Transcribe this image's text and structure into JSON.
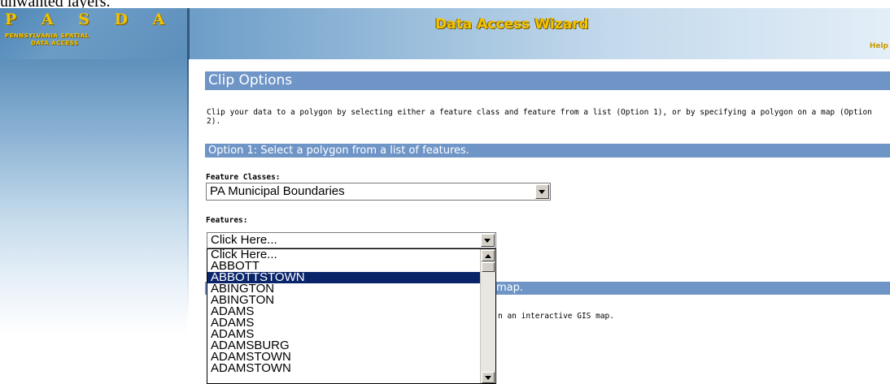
{
  "page_caption": "unwanted layers.",
  "header": {
    "logo_letters": "P A S D A",
    "logo_line1": "PENNSYLVANIA SPATIAL",
    "logo_line2": "DATA ACCESS",
    "title": "Data Access Wizard",
    "help_label": "Help"
  },
  "clip_options": {
    "heading": "Clip Options",
    "intro": "Clip your data to a polygon by selecting either a feature class and feature from a list (Option 1), or by specifying a polygon on a map (Option 2)."
  },
  "option1": {
    "heading": "Option 1: Select a polygon from a list of features.",
    "feature_classes_label": "Feature Classes:",
    "feature_classes_value": "PA Municipal Boundaries",
    "features_label": "Features:",
    "features_value": "Click Here...",
    "features_options": [
      "Click Here...",
      "ABBOTT",
      "ABBOTTSTOWN",
      "ABINGTON",
      "ABINGTON",
      "ADAMS",
      "ADAMS",
      "ADAMS",
      "ADAMSBURG",
      "ADAMSTOWN",
      "ADAMSTOWN"
    ],
    "selected_option_index": 2
  },
  "option2": {
    "heading_visible": "map.",
    "text_visible": "n an interactive GIS map."
  },
  "colors": {
    "section_bar": "#6f95c7",
    "selected_item": "#0a246a",
    "title_gold": "#f5c400"
  }
}
